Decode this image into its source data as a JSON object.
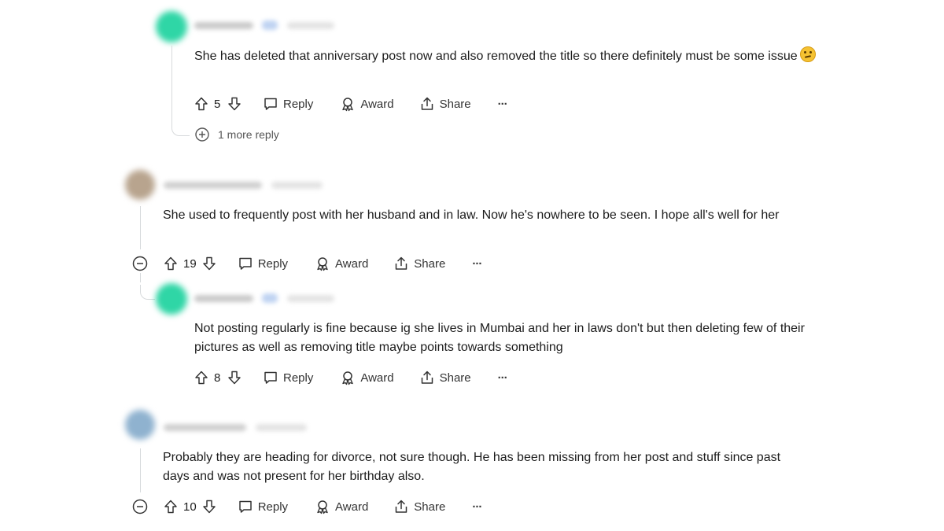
{
  "comments": [
    {
      "text": "She has deleted that anniversary post now and also removed the title so there definitely must be some issue",
      "votes": "5",
      "more_replies": "1 more reply"
    },
    {
      "text": "She used to frequently post with her husband and in law. Now he's nowhere to be seen. I hope all's well for her",
      "votes": "19"
    },
    {
      "text": "Not posting regularly is fine because ig she lives in Mumbai and her in laws don't but then deleting few of their pictures as well as removing title maybe points towards something",
      "votes": "8"
    },
    {
      "text": "Probably they are heading for divorce, not sure though. He has been missing from her post and stuff since past days and was not present for her birthday also.",
      "votes": "10"
    }
  ],
  "labels": {
    "reply": "Reply",
    "award": "Award",
    "share": "Share",
    "more": "···"
  },
  "icons": [
    "upvote-icon",
    "downvote-icon",
    "comment-icon",
    "award-icon",
    "share-icon",
    "more-icon",
    "expand-icon",
    "collapse-icon"
  ],
  "colors": {
    "avatar_green": "#2fd6a6",
    "avatar_tan": "#b8a48e",
    "avatar_blue": "#8fb2cf",
    "thread_line": "#d7dadc"
  }
}
